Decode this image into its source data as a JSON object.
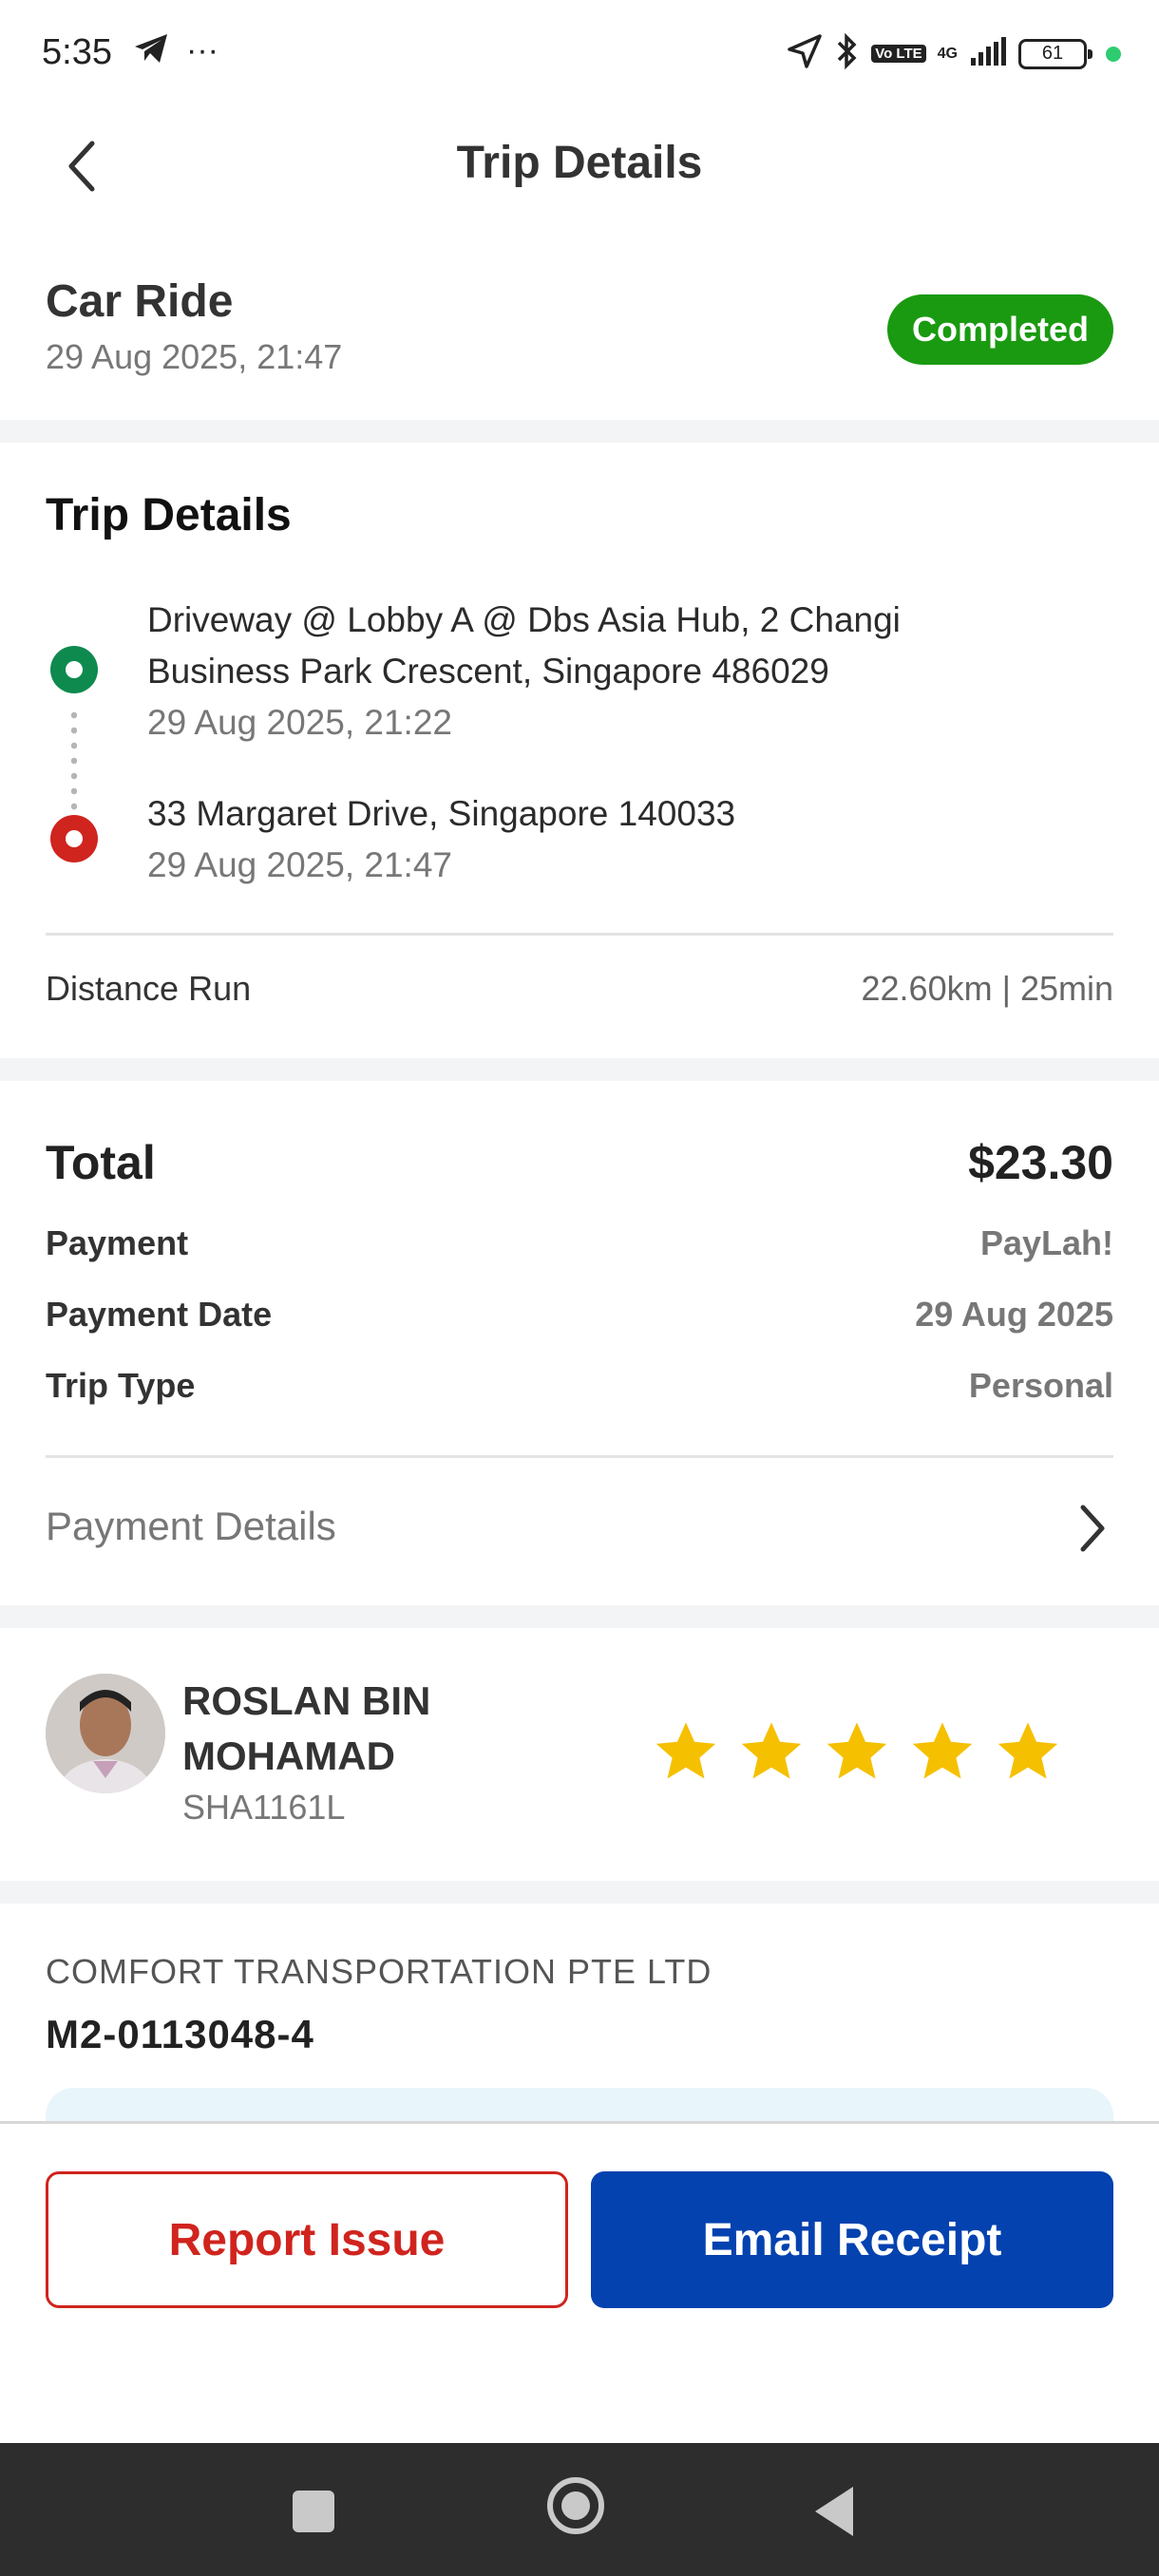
{
  "status_bar": {
    "time": "5:35",
    "more": "···",
    "volte": "Vo LTE",
    "network": "4G",
    "battery": "61"
  },
  "header": {
    "title": "Trip Details",
    "back_icon": "chevron-left-icon"
  },
  "summary": {
    "ride_type": "Car Ride",
    "datetime": "29 Aug 2025, 21:47",
    "status": "Completed",
    "status_color": "#1a9a11"
  },
  "trip": {
    "section_title": "Trip Details",
    "pickup": {
      "address_line1": "Driveway @ Lobby A @ Dbs Asia Hub, 2 Changi",
      "address_line2": "Business Park Crescent, Singapore 486029",
      "time": "29 Aug 2025, 21:22",
      "color": "#0e8a4f"
    },
    "dropoff": {
      "address": "33 Margaret Drive, Singapore 140033",
      "time": "29 Aug 2025, 21:47",
      "color": "#d0241e"
    },
    "distance_label": "Distance Run",
    "distance_value": "22.60km | 25min"
  },
  "payment": {
    "total_label": "Total",
    "total_value": "$23.30",
    "rows": [
      {
        "label": "Payment",
        "value": "PayLah!"
      },
      {
        "label": "Payment Date",
        "value": "29 Aug 2025"
      },
      {
        "label": "Trip Type",
        "value": "Personal"
      }
    ],
    "details_link": "Payment Details"
  },
  "driver": {
    "name_line1": "ROSLAN BIN",
    "name_line2": "MOHAMAD",
    "plate": "SHA1161L",
    "rating": 5,
    "rating_max": 5,
    "star_color": "#f5c000"
  },
  "company": {
    "name": "COMFORT TRANSPORTATION PTE LTD",
    "licence": "M2-0113048-4"
  },
  "actions": {
    "report": "Report Issue",
    "email": "Email Receipt",
    "report_color": "#d0241e",
    "email_color": "#0442b0"
  }
}
